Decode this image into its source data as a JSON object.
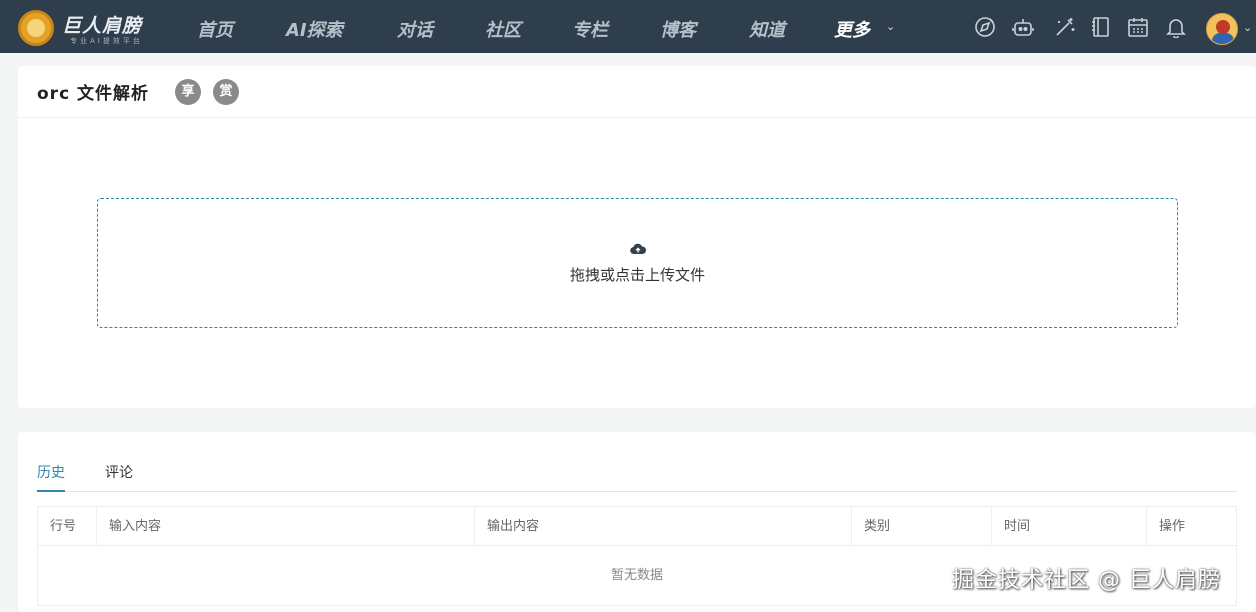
{
  "header": {
    "brand": "巨人肩膀",
    "slogan": "专业AI提效平台",
    "nav": [
      {
        "label": "首页"
      },
      {
        "label": "AI探索"
      },
      {
        "label": "对话"
      },
      {
        "label": "社区"
      },
      {
        "label": "专栏"
      },
      {
        "label": "博客"
      },
      {
        "label": "知道"
      },
      {
        "label": "更多"
      }
    ],
    "tool_icons": [
      "compass-icon",
      "robot-icon",
      "magic-wand-icon",
      "notebook-icon",
      "calendar-icon",
      "bell-icon"
    ]
  },
  "page": {
    "title": "orc 文件解析",
    "share_button": "享",
    "reward_button": "赏"
  },
  "upload": {
    "text": "拖拽或点击上传文件"
  },
  "history": {
    "tabs": [
      {
        "label": "历史"
      },
      {
        "label": "评论"
      }
    ],
    "columns": [
      "行号",
      "输入内容",
      "输出内容",
      "类别",
      "时间",
      "操作"
    ],
    "empty_text": "暂无数据"
  },
  "watermark": "掘金技术社区 @ 巨人肩膀",
  "colors": {
    "topbar": "#2f3e4c",
    "accent": "#2f86ad"
  }
}
